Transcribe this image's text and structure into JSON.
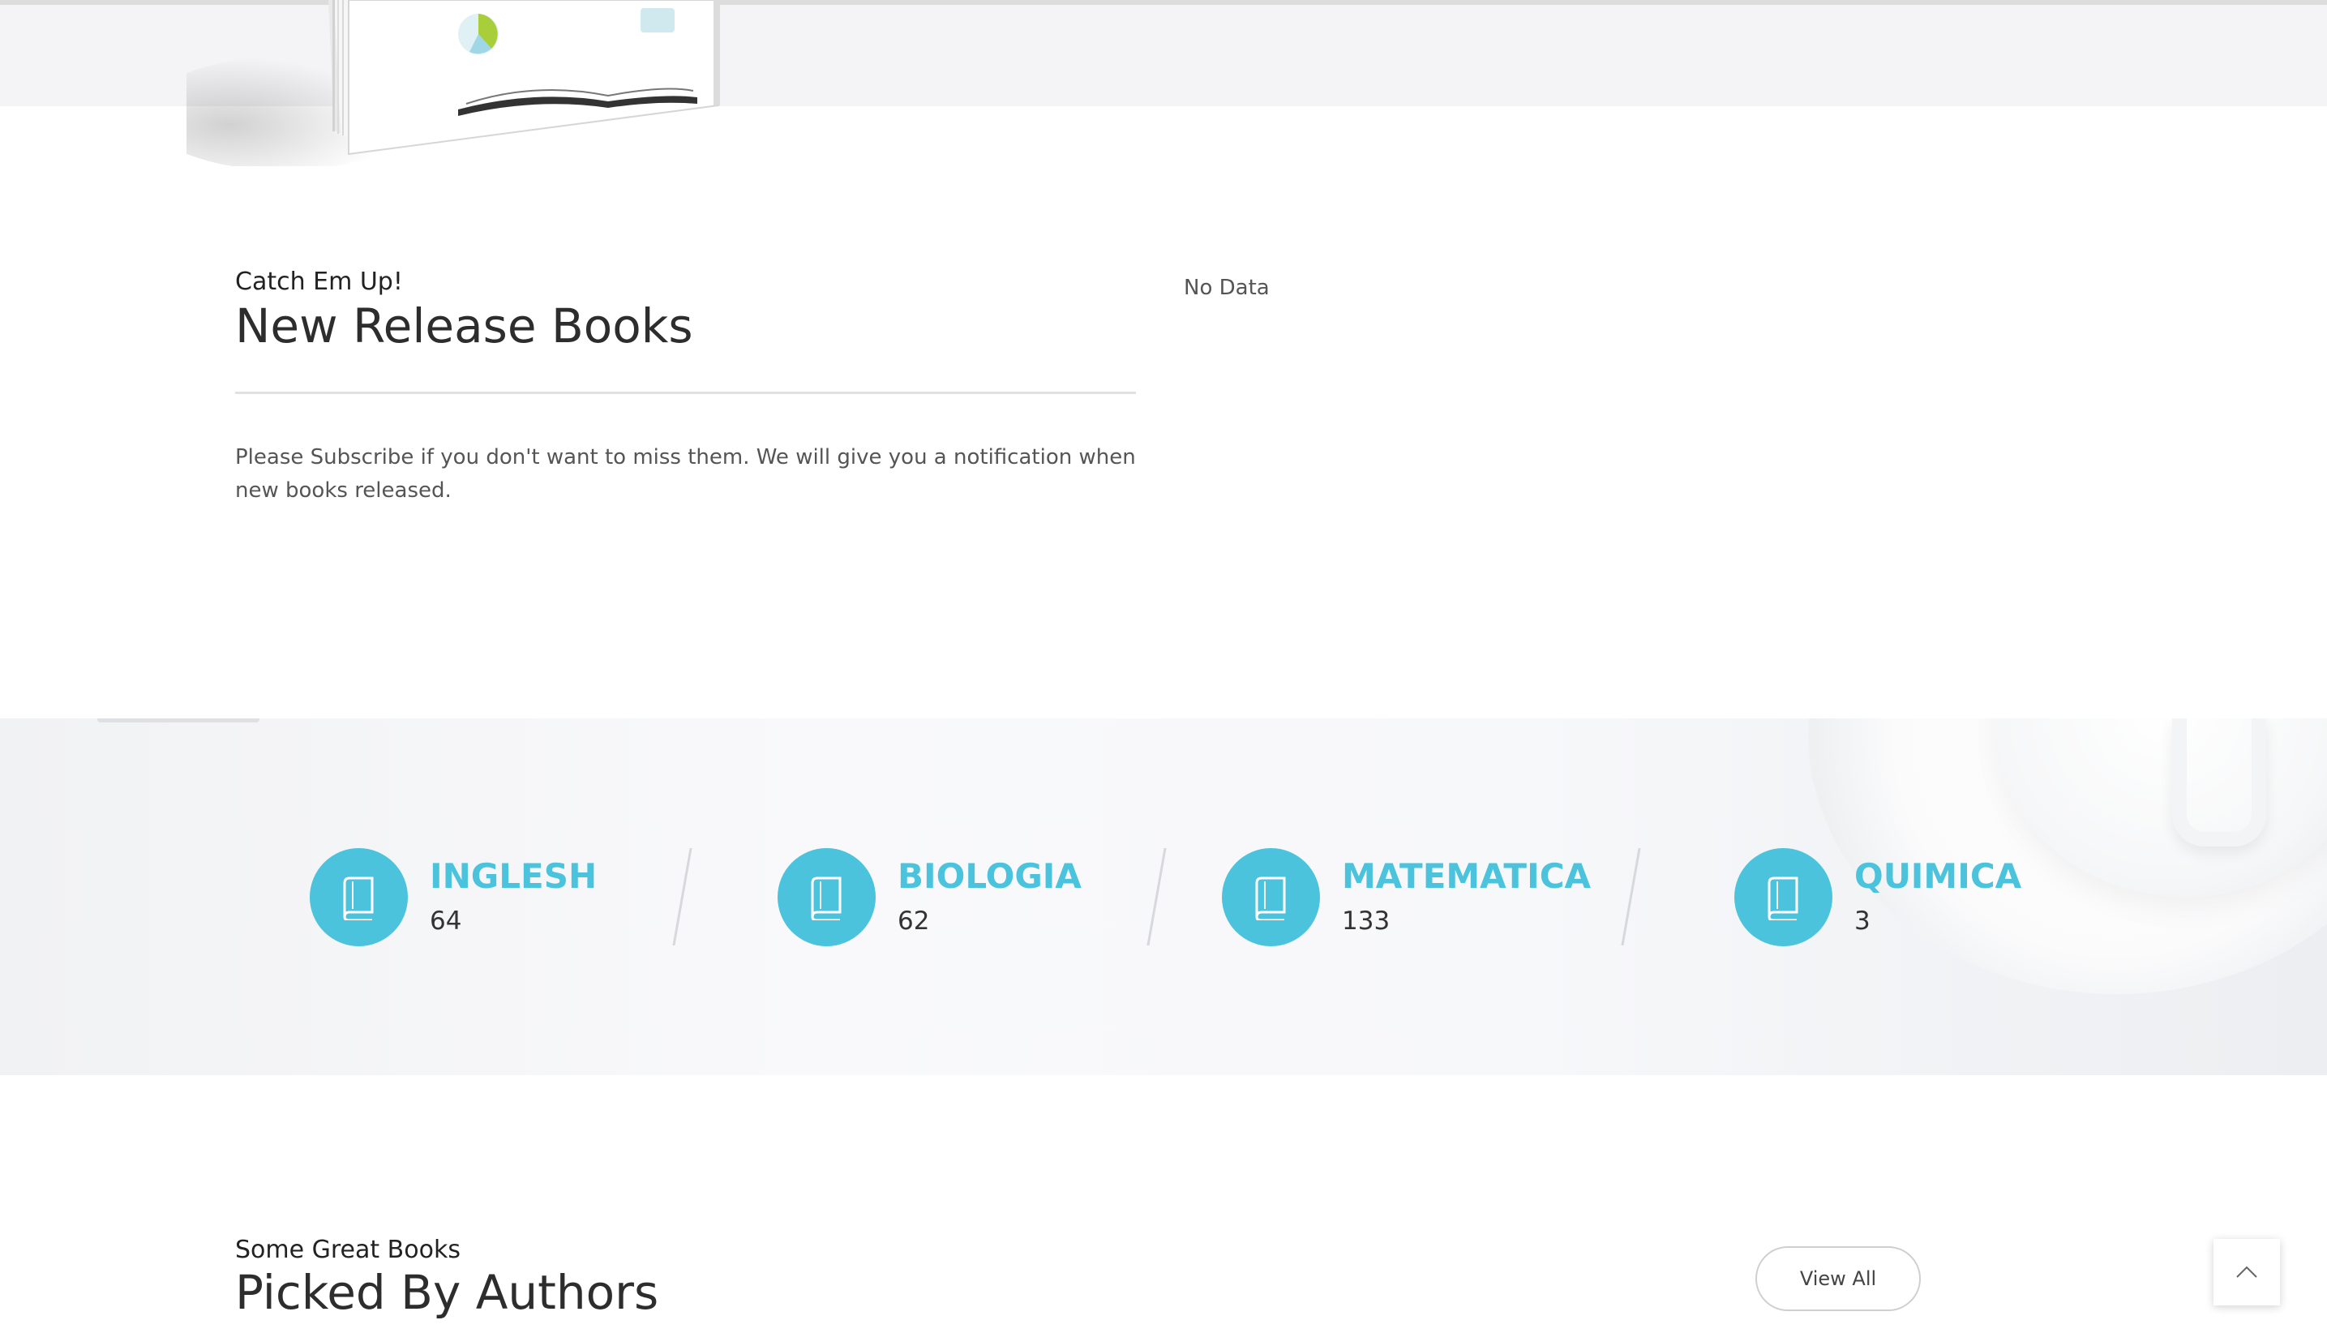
{
  "new_release": {
    "eyebrow": "Catch Em Up!",
    "title": "New Release Books",
    "description": "Please Subscribe if you don't want to miss them. We will give you a notification when new books released.",
    "empty_state": "No Data"
  },
  "stats": [
    {
      "name": "INGLESH",
      "count": "64",
      "icon": "book-icon"
    },
    {
      "name": "BIOLOGIA",
      "count": "62",
      "icon": "book-icon"
    },
    {
      "name": "MATEMATICA",
      "count": "133",
      "icon": "book-icon"
    },
    {
      "name": "QUIMICA",
      "count": "3",
      "icon": "book-icon"
    }
  ],
  "picked": {
    "eyebrow": "Some Great Books",
    "title": "Picked By Authors",
    "view_all_label": "View All"
  },
  "back_to_top_icon": "chevron-up-icon",
  "colors": {
    "accent": "#4bc3dc",
    "band": "#f4f4f6"
  }
}
